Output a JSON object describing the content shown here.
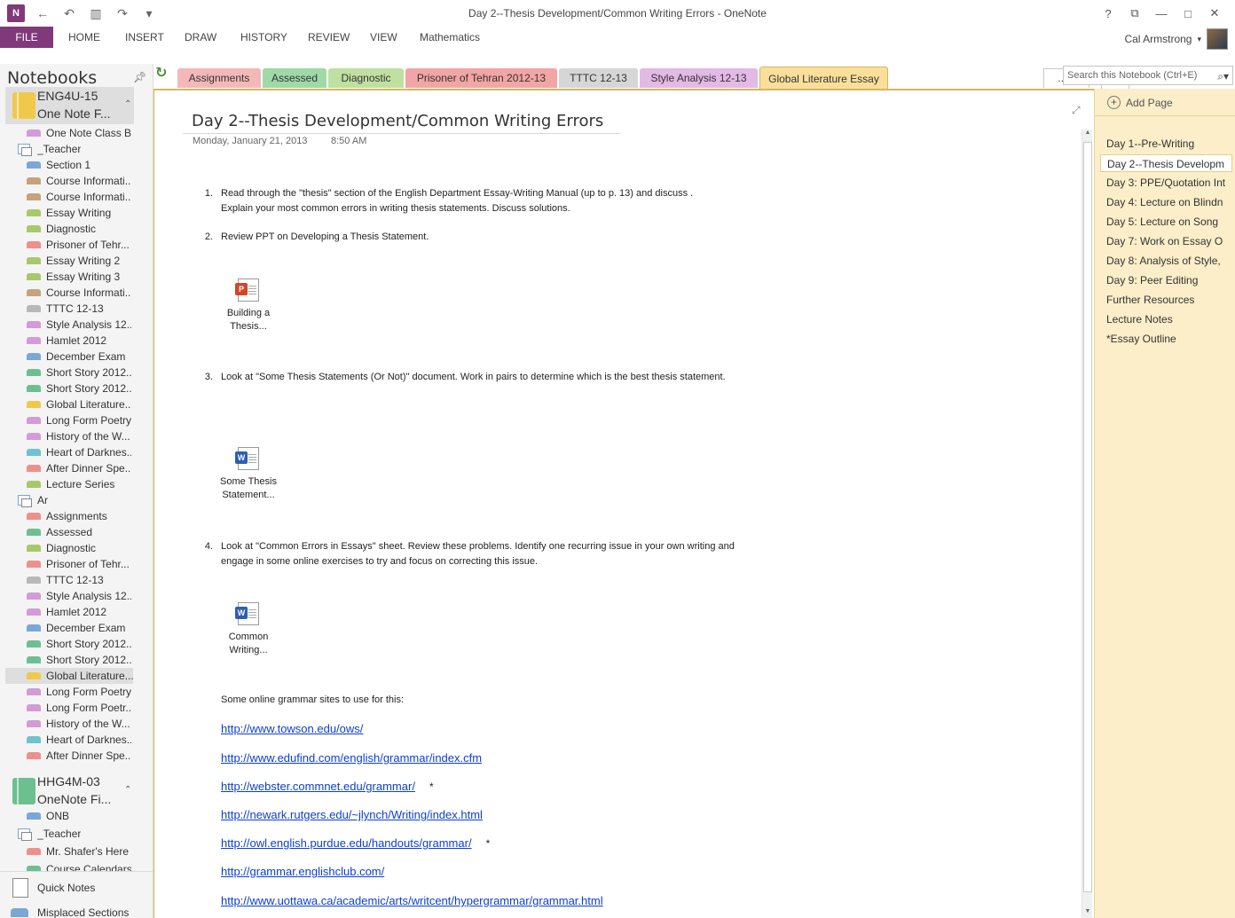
{
  "window": {
    "title": "Day 2--Thesis Development/Common Writing Errors - OneNote",
    "app_logo": "N",
    "controls": [
      "?",
      "⧉",
      "—",
      "□",
      "✕"
    ]
  },
  "ribbon": {
    "file": "FILE",
    "tabs": [
      "HOME",
      "INSERT",
      "DRAW",
      "HISTORY",
      "REVIEW",
      "VIEW",
      "Mathematics"
    ],
    "user": "Cal Armstrong"
  },
  "notebooks": {
    "header": "Notebooks",
    "book1": {
      "line1": "ENG4U-15",
      "line2": "One Note F...",
      "color": "#f1c94a"
    },
    "book1_sections": [
      {
        "label": "One Note Class Bi...",
        "color": "#d59ad8"
      },
      {
        "label": "_Teacher",
        "group": true
      },
      {
        "label": "Section 1",
        "color": "#7aa7d6"
      },
      {
        "label": "Course Informati...",
        "color": "#c7a27c"
      },
      {
        "label": "Course Informati...",
        "color": "#c7a27c"
      },
      {
        "label": "Essay Writing",
        "color": "#a6c96a"
      },
      {
        "label": "Diagnostic",
        "color": "#a6c96a"
      },
      {
        "label": "Prisoner of Tehr...",
        "color": "#ee8f8f"
      },
      {
        "label": "Essay Writing 2",
        "color": "#a6c96a"
      },
      {
        "label": "Essay Writing 3",
        "color": "#a6c96a"
      },
      {
        "label": "Course Informati...",
        "color": "#c7a27c"
      },
      {
        "label": "TTTC 12-13",
        "color": "#b8b8b8"
      },
      {
        "label": "Style Analysis 12...",
        "color": "#d59ad8"
      },
      {
        "label": "Hamlet 2012",
        "color": "#d59ad8"
      },
      {
        "label": "December Exam",
        "color": "#7aa7d6"
      },
      {
        "label": "Short Story 2012...",
        "color": "#6cc08f"
      },
      {
        "label": "Short Story 2012...",
        "color": "#6cc08f"
      },
      {
        "label": "Global Literature...",
        "color": "#f1c94a"
      },
      {
        "label": "Long Form Poetry",
        "color": "#d59ad8"
      },
      {
        "label": "History of the W...",
        "color": "#d59ad8"
      },
      {
        "label": "Heart of Darknes...",
        "color": "#6fc2d0"
      },
      {
        "label": "After Dinner Spe...",
        "color": "#ee8f8f"
      },
      {
        "label": "Lecture Series",
        "color": "#a6c96a"
      },
      {
        "label": "Ar",
        "group": true
      },
      {
        "label": "Assignments",
        "color": "#ee8f8f"
      },
      {
        "label": "Assessed",
        "color": "#6cc08f"
      },
      {
        "label": "Diagnostic",
        "color": "#a6c96a"
      },
      {
        "label": "Prisoner of Tehr...",
        "color": "#ee8f8f"
      },
      {
        "label": "TTTC 12-13",
        "color": "#b8b8b8"
      },
      {
        "label": "Style Analysis 12...",
        "color": "#d59ad8"
      },
      {
        "label": "Hamlet 2012",
        "color": "#d59ad8"
      },
      {
        "label": "December Exam",
        "color": "#7aa7d6"
      },
      {
        "label": "Short Story 2012...",
        "color": "#6cc08f"
      },
      {
        "label": "Short Story 2012...",
        "color": "#6cc08f"
      },
      {
        "label": "Global Literature...",
        "color": "#f1c94a",
        "selected": true
      },
      {
        "label": "Long Form Poetry",
        "color": "#d59ad8"
      },
      {
        "label": "Long Form Poetr...",
        "color": "#d59ad8"
      },
      {
        "label": "History of the W...",
        "color": "#d59ad8"
      },
      {
        "label": "Heart of Darknes...",
        "color": "#6fc2d0"
      },
      {
        "label": "After Dinner Spe...",
        "color": "#ee8f8f"
      }
    ],
    "book2": {
      "line1": "HHG4M-03",
      "line2": "OneNote Fi...",
      "color": "#6cc08f"
    },
    "book2_sections": [
      {
        "label": "ONB",
        "color": "#7aa7d6"
      },
      {
        "label": "_Teacher",
        "group": true
      },
      {
        "label": "Mr. Shafer's Here",
        "color": "#ee8f8f"
      },
      {
        "label": "Course Calendars",
        "color": "#6cc08f"
      }
    ],
    "quick_notes": "Quick Notes",
    "misplaced": "Misplaced Sections"
  },
  "section_tabs": [
    {
      "label": "Assignments",
      "color": "#f4b8b8"
    },
    {
      "label": "Assessed",
      "color": "#9fd9a8"
    },
    {
      "label": "Diagnostic",
      "color": "#bfe0a0"
    },
    {
      "label": "Prisoner of Tehran 2012-13",
      "color": "#f2a5a5"
    },
    {
      "label": "TTTC 12-13",
      "color": "#d6d6d6"
    },
    {
      "label": "Style Analysis 12-13",
      "color": "#e3b9e5"
    },
    {
      "label": "Global Literature Essay",
      "color": "#fadf9b",
      "active": true
    }
  ],
  "more_tabs": "...",
  "add_tab": "+",
  "search": {
    "placeholder": "Search this Notebook (Ctrl+E)"
  },
  "page": {
    "title": "Day 2--Thesis Development/Common Writing Errors",
    "date": "Monday, January 21, 2013",
    "time": "8:50 AM",
    "steps": [
      {
        "num": "1.",
        "text": "Read through the \"thesis\" section of the English Department Essay-Writing Manual (up to p. 13) and discuss .  Explain your most common errors in writing thesis statements.  Discuss solutions."
      },
      {
        "num": "2.",
        "text": "Review PPT on Developing a Thesis Statement."
      },
      {
        "num": "3.",
        "text": "Look at \"Some Thesis Statements (Or Not)\" document.  Work in pairs to determine which is the best thesis statement."
      },
      {
        "num": "4.",
        "text": "Look at \"Common Errors in Essays\" sheet. Review these problems.  Identify one recurring issue in your own writing and engage in some online exercises to try and focus on correcting this issue."
      }
    ],
    "attachments": [
      {
        "line1": "Building a",
        "line2": "Thesis...",
        "badge": "P",
        "badge_color": "#d24726"
      },
      {
        "line1": "Some Thesis",
        "line2": "Statement...",
        "badge": "W",
        "badge_color": "#2b5fb4"
      },
      {
        "line1": "Common",
        "line2": "Writing...",
        "badge": "W",
        "badge_color": "#2b5fb4"
      }
    ],
    "grammar_intro": "Some online grammar sites to use for this:",
    "links": [
      {
        "url": "http://www.towson.edu/ows/",
        "star": ""
      },
      {
        "url": "http://www.edufind.com/english/grammar/index.cfm",
        "star": ""
      },
      {
        "url": "http://webster.commnet.edu/grammar/",
        "star": "*"
      },
      {
        "url": "http://newark.rutgers.edu/~jlynch/Writing/index.html",
        "star": ""
      },
      {
        "url": "http://owl.english.purdue.edu/handouts/grammar/",
        "star": "*"
      },
      {
        "url": "http://grammar.englishclub.com/",
        "star": ""
      },
      {
        "url": "http://www.uottawa.ca/academic/arts/writcent/hypergrammar/grammar.html",
        "star": ""
      }
    ]
  },
  "pages": {
    "add_page": "Add Page",
    "items": [
      {
        "label": "Day 1--Pre-Writing"
      },
      {
        "label": "Day 2--Thesis Developm",
        "selected": true
      },
      {
        "label": "Day 3: PPE/Quotation Int"
      },
      {
        "label": "Day 4: Lecture on Blindn"
      },
      {
        "label": "Day 5:  Lecture on Song"
      },
      {
        "label": "Day 7:  Work on Essay O"
      },
      {
        "label": "Day 8: Analysis of Style,"
      },
      {
        "label": "Day 9:  Peer Editing"
      },
      {
        "label": "Further Resources"
      },
      {
        "label": "Lecture Notes"
      },
      {
        "label": "*Essay Outline"
      }
    ]
  }
}
